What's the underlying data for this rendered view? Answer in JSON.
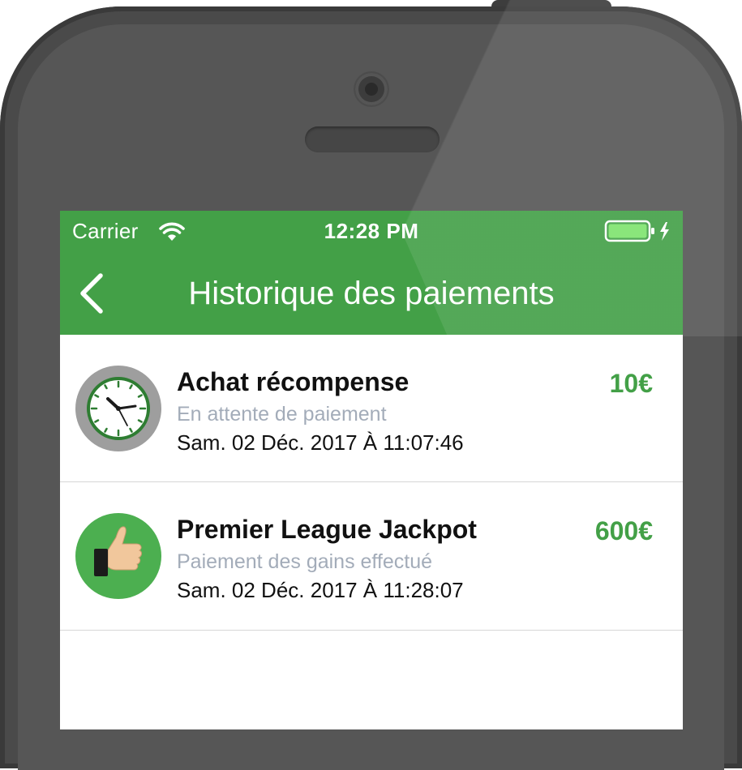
{
  "status_bar": {
    "carrier": "Carrier",
    "time": "12:28 PM"
  },
  "nav": {
    "title": "Historique des paiements"
  },
  "colors": {
    "accent": "#43a047",
    "status_text": "#a3acb9",
    "pending_ring": "#9e9e9e",
    "thumb_bg": "#4caf50"
  },
  "payments": [
    {
      "title": "Achat récompense",
      "status": "En attente de paiement",
      "date": "Sam. 02 Déc. 2017 À 11:07:46",
      "amount": "10€",
      "icon": "clock-icon"
    },
    {
      "title": "Premier League Jackpot",
      "status": "Paiement des gains effectué",
      "date": "Sam. 02 Déc. 2017 À 11:28:07",
      "amount": "600€",
      "icon": "thumbs-up-icon"
    }
  ]
}
